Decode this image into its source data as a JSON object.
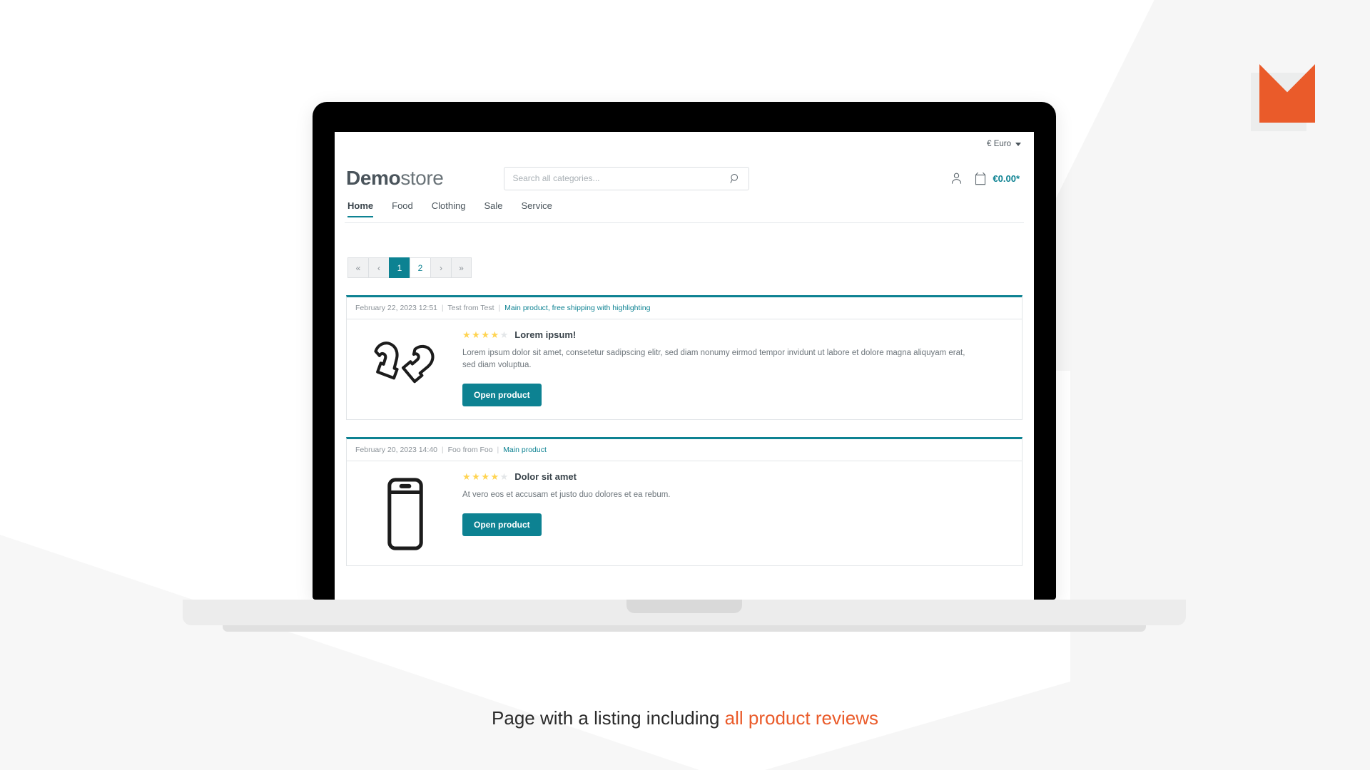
{
  "caption": {
    "text": "Page with a listing including ",
    "highlight": "all product reviews"
  },
  "brand_logo": {
    "name": "m-mark-logo",
    "color": "#ea5b2a"
  },
  "colors": {
    "accent": "#0d8292",
    "orange": "#ea5b2a",
    "star": "#ffd452",
    "star_empty": "#e3e6e8",
    "text": "#4a545b"
  },
  "shop": {
    "topbar": {
      "currency_label": "€ Euro",
      "caret_icon": "chevron-down-icon"
    },
    "header": {
      "logo_bold": "Demo",
      "logo_light": "store",
      "search": {
        "placeholder": "Search all categories...",
        "value": "",
        "icon": "search-icon"
      },
      "account_icon": "user-icon",
      "cart_icon": "bag-icon",
      "cart_total": "€0.00*"
    },
    "nav": {
      "items": [
        {
          "label": "Home",
          "active": true
        },
        {
          "label": "Food",
          "active": false
        },
        {
          "label": "Clothing",
          "active": false
        },
        {
          "label": "Sale",
          "active": false
        },
        {
          "label": "Service",
          "active": false
        }
      ]
    },
    "pagination": {
      "first_label": "«",
      "prev_label": "‹",
      "pages": [
        {
          "label": "1",
          "active": true
        },
        {
          "label": "2",
          "active": false
        }
      ],
      "next_label": "›",
      "last_label": "»"
    },
    "reviews": [
      {
        "date": "February 22, 2023 12:51",
        "author": "Test from Test",
        "product_link": "Main product, free shipping with highlighting",
        "image_icon": "mittens-icon",
        "rating": 4,
        "rating_max": 5,
        "title": "Lorem ipsum!",
        "text": "Lorem ipsum dolor sit amet, consetetur sadipscing elitr, sed diam nonumy eirmod tempor invidunt ut labore et dolore magna aliquyam erat, sed diam voluptua.",
        "button_label": "Open product"
      },
      {
        "date": "February 20, 2023 14:40",
        "author": "Foo from Foo",
        "product_link": "Main product",
        "image_icon": "smartphone-icon",
        "rating": 4,
        "rating_max": 5,
        "title": "Dolor sit amet",
        "text": "At vero eos et accusam et justo duo dolores et ea rebum.",
        "button_label": "Open product"
      }
    ]
  }
}
